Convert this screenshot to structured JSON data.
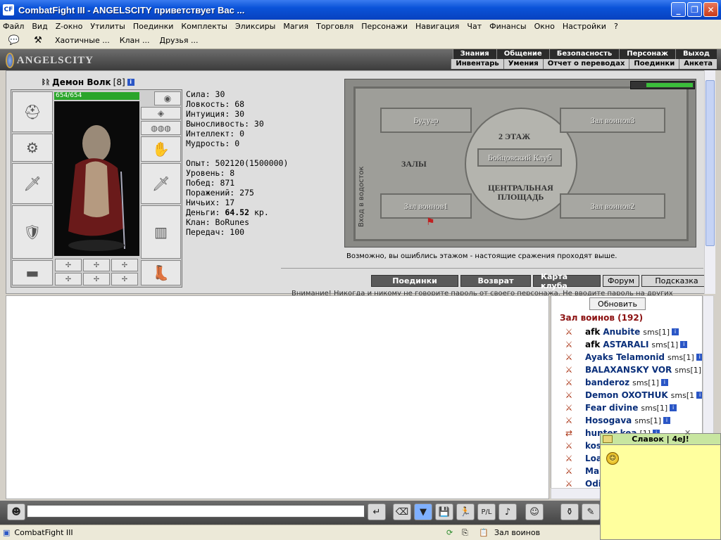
{
  "window": {
    "title": "CombatFight III - ANGELSCITY приветствует Вас ...",
    "min": "_",
    "max": "❐",
    "close": "✕"
  },
  "menu": [
    "Файл",
    "Вид",
    "Z-окно",
    "Утилиты",
    "Поединки",
    "Комплекты",
    "Эликсиры",
    "Магия",
    "Торговля",
    "Персонажи",
    "Навигация",
    "Чат",
    "Финансы",
    "Окно",
    "Настройки",
    "?"
  ],
  "toolbar": {
    "links": [
      "Хаотичные ...",
      "Клан ...",
      "Друзья ..."
    ]
  },
  "banner": {
    "logo": "ANGELSCITY",
    "nav_top": [
      "Знания",
      "Общение",
      "Безопасность",
      "Персонаж",
      "Выход"
    ],
    "nav_bottom": [
      "Инвентарь",
      "Умения",
      "Отчет о переводах",
      "Поединки",
      "Анкета"
    ]
  },
  "character": {
    "name": "Демон Волк",
    "level": "[8]",
    "hp": "654/654",
    "hp_fraction": 1.0,
    "info_icon": "i",
    "stats": [
      "Сила: 30",
      "Ловкость: 68",
      "Интуиция: 30",
      "Выносливость: 30",
      "Интеллект: 0",
      "Мудрость: 0"
    ],
    "details": [
      "Опыт: 502120(1500000)",
      "Уровень: 8",
      "Побед: 871",
      "Поражений: 275",
      "Ничьих: 17"
    ],
    "money_label": "Деньги:",
    "money_value": "64.52",
    "money_unit": "кр.",
    "details2": [
      "Клан: BoRunes",
      "Передач: 100"
    ]
  },
  "map": {
    "halls": {
      "boudoir": "Будуар",
      "warriors3": "Зал воинов3",
      "floor": "2 ЭТАЖ",
      "club": "Бойцовский Клуб",
      "halls": "ЗАЛЫ",
      "square": "ЦЕНТРАЛЬНАЯ ПЛОЩАДЬ",
      "warriors1": "Зал воинов1",
      "warriors2": "Зал воинов2",
      "entrance": "Вход в водосток"
    },
    "caption": "Возможно, вы ошиблись этажом - настоящие сражения проходят выше."
  },
  "actions": {
    "fights": "Поединки",
    "back": "Возврат",
    "club_map": "Карта клуба",
    "forum": "Форум",
    "hint": "Подсказка"
  },
  "warning": "Внимание! Никогда и никому не говорите пароль от своего персонажа. Не вводите пароль на других",
  "who": {
    "refresh": "Обновить",
    "hall": "Зал воинов (192)",
    "players": [
      {
        "afk": "afk",
        "nick": "Anubite",
        "sms": "sms[1]"
      },
      {
        "afk": "afk",
        "nick": "ASTARALI",
        "sms": "sms[1]"
      },
      {
        "afk": "",
        "nick": "Ayaks Telamonid",
        "sms": "sms[1]"
      },
      {
        "afk": "",
        "nick": "BALAXANSKY VOR",
        "sms": "sms[1]"
      },
      {
        "afk": "",
        "nick": "banderoz",
        "sms": "sms[1]"
      },
      {
        "afk": "",
        "nick": "Demon OXOTHUK",
        "sms": "sms[1"
      },
      {
        "afk": "",
        "nick": "Fear divine",
        "sms": "sms[1]"
      },
      {
        "afk": "",
        "nick": "Hosogava",
        "sms": "sms[1]"
      },
      {
        "afk": "",
        "nick": "hunter kea",
        "sms": "[1]"
      },
      {
        "afk": "",
        "nick": "kos",
        "sms": ""
      },
      {
        "afk": "",
        "nick": "Loa",
        "sms": ""
      },
      {
        "afk": "",
        "nick": "Ma",
        "sms": ""
      },
      {
        "afk": "",
        "nick": "Odi",
        "sms": ""
      }
    ]
  },
  "popup": {
    "title": "Славок | 4eJ!"
  },
  "statusbar": {
    "app": "CombatFight III",
    "location": "Зал воинов"
  }
}
